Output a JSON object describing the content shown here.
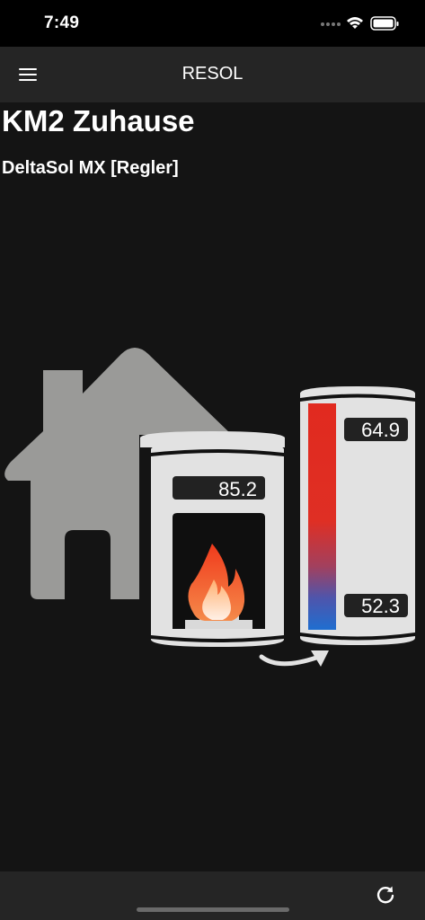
{
  "status_bar": {
    "time": "7:49"
  },
  "app_bar": {
    "title": "RESOL"
  },
  "page": {
    "title": "KM2 Zuhause",
    "subtitle": "DeltaSol MX [Regler]"
  },
  "scheme": {
    "boiler_temp": "85.2",
    "tank_top_temp": "64.9",
    "tank_bottom_temp": "52.3"
  },
  "colors": {
    "background": "#141414",
    "bar": "#252525",
    "hot": "#e12a1f",
    "cold": "#1f6ed0",
    "house": "#9a9a98"
  },
  "icons": {
    "menu": "hamburger-menu-icon",
    "refresh": "refresh-icon"
  }
}
